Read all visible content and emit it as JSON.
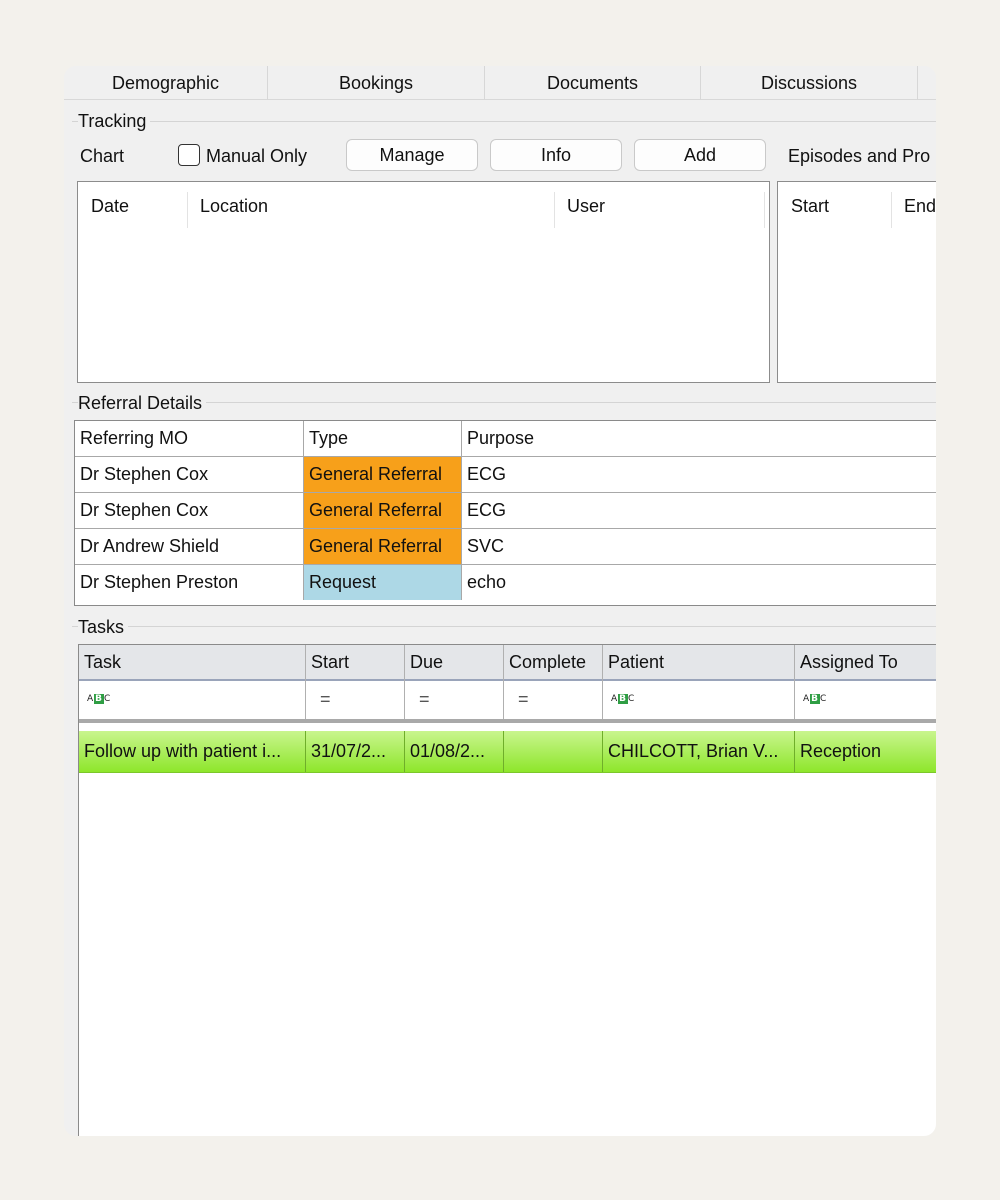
{
  "tabs": [
    "Demographic",
    "Bookings",
    "Documents",
    "Discussions"
  ],
  "tracking": {
    "title": "Tracking",
    "chart_label": "Chart",
    "manual_only_label": "Manual Only",
    "manual_only_checked": false,
    "buttons": {
      "manage": "Manage",
      "info": "Info",
      "add": "Add"
    },
    "episodes_label": "Episodes and Pro",
    "list_columns": [
      "Date",
      "Location",
      "User"
    ],
    "episode_columns": [
      "Start",
      "End"
    ]
  },
  "referral": {
    "title": "Referral Details",
    "columns": [
      "Referring MO",
      "Type",
      "Purpose"
    ],
    "rows": [
      {
        "mo": "Dr Stephen Cox",
        "type": "General Referral",
        "purpose": "ECG",
        "type_color": "#f7a01a"
      },
      {
        "mo": "Dr Stephen Cox",
        "type": "General Referral",
        "purpose": "ECG",
        "type_color": "#f7a01a"
      },
      {
        "mo": "Dr Andrew Shield",
        "type": "General Referral",
        "purpose": "SVC",
        "type_color": "#f7a01a"
      },
      {
        "mo": "Dr Stephen Preston",
        "type": "Request",
        "purpose": "echo",
        "type_color": "#add8e6"
      }
    ]
  },
  "tasks": {
    "title": "Tasks",
    "columns": [
      "Task",
      "Start",
      "Due",
      "Complete",
      "Patient",
      "Assigned To"
    ],
    "filter_icons": [
      "text-filter-icon",
      "equals-filter-icon",
      "equals-filter-icon",
      "equals-filter-icon",
      "text-filter-icon",
      "text-filter-icon"
    ],
    "filter_abc": "ABC",
    "filter_eq": "=",
    "rows": [
      {
        "task": "Follow up with patient i...",
        "start": "31/07/2...",
        "due": "01/08/2...",
        "complete": "",
        "patient": "CHILCOTT, Brian V...",
        "assigned": "Reception"
      }
    ]
  }
}
